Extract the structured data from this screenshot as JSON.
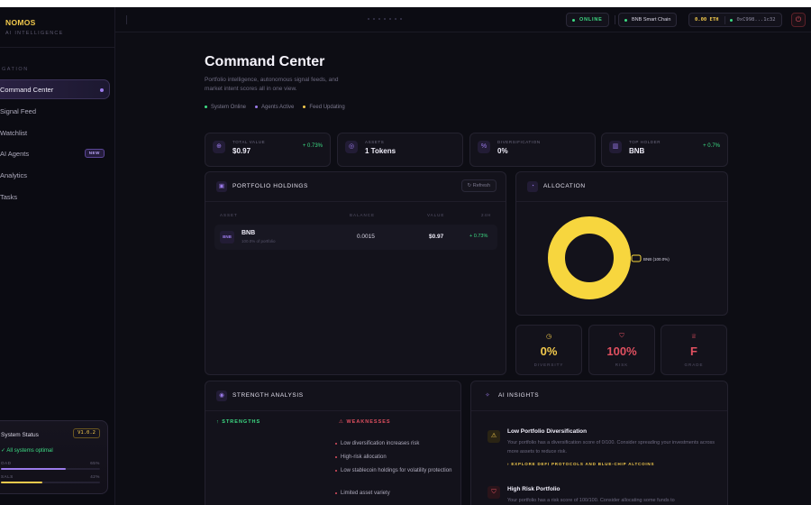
{
  "brand": {
    "name": "NOMOS",
    "tagline": "AI INTELLIGENCE"
  },
  "sidebar": {
    "heading": "GATION",
    "items": [
      {
        "label": "Command Center",
        "active": true
      },
      {
        "label": "Signal Feed"
      },
      {
        "label": "Watchlist"
      },
      {
        "label": "AI Agents",
        "badge": "NEW"
      },
      {
        "label": "Analytics"
      },
      {
        "label": "Tasks"
      }
    ],
    "status": {
      "title": "System Status",
      "version": "V1.0.2",
      "message": "All systems optimal",
      "bars": [
        {
          "label": "OAD",
          "value": "65%",
          "level": 0.65,
          "color": "#9b7bea"
        },
        {
          "label": "SALS",
          "value": "42%",
          "level": 0.42,
          "color": "#f2c94c"
        }
      ]
    }
  },
  "topbar": {
    "online": "ONLINE",
    "chain": "BNB Smart Chain",
    "eth": "0.00 ETH",
    "address": "0xC998...1c32",
    "power_icon": "power-icon"
  },
  "main": {
    "title": "Command Center",
    "subtitle": "Portfolio intelligence, autonomous signal feeds, and market intent scores all in one view.",
    "legend": [
      {
        "label": "System Online",
        "color": "#3ddc84"
      },
      {
        "label": "Agents Active",
        "color": "#9b7bea"
      },
      {
        "label": "Feed Updating",
        "color": "#f2c94c"
      }
    ]
  },
  "stats": [
    {
      "label": "TOTAL VALUE",
      "value": "$0.97",
      "delta": "+ 0.73%",
      "icon": "globe-icon"
    },
    {
      "label": "ASSETS",
      "value": "1 Tokens",
      "delta": "",
      "icon": "coins-icon"
    },
    {
      "label": "DIVERSIFICATION",
      "value": "0%",
      "delta": "",
      "icon": "percent-icon"
    },
    {
      "label": "TOP HOLDER",
      "value": "BNB",
      "delta": "+ 0.7%",
      "icon": "chart-icon"
    }
  ],
  "holdings": {
    "title": "PORTFOLIO HOLDINGS",
    "refresh": "Refresh",
    "columns": [
      "ASSET",
      "BALANCE",
      "VALUE",
      "24H"
    ],
    "rows": [
      {
        "badge": "BNB",
        "name": "BNB",
        "sub": "100.0% of portfolio",
        "balance": "0.0015",
        "value": "$0.97",
        "change": "+ 0.73%"
      }
    ]
  },
  "allocation": {
    "title": "ALLOCATION",
    "label": "BNB (100.0%)",
    "color": "#f7d63e"
  },
  "chart_data": {
    "type": "pie",
    "categories": [
      "BNB"
    ],
    "values": [
      100.0
    ],
    "title": "ALLOCATION",
    "labels": [
      "BNB (100.0%)"
    ]
  },
  "scores": [
    {
      "value": "0%",
      "label": "DIVERSITY",
      "color": "#f2c94c",
      "icon": "clock-icon"
    },
    {
      "value": "100%",
      "label": "RISK",
      "color": "#e05060",
      "icon": "shield-icon"
    },
    {
      "value": "F",
      "label": "GRADE",
      "color": "#e05060",
      "icon": "trophy-icon"
    }
  ],
  "strength": {
    "title": "STRENGTH ANALYSIS",
    "strengths_label": "STRENGTHS",
    "weaknesses_label": "WEAKNESSES",
    "weaknesses": [
      "Low diversification increases risk",
      "High-risk allocation",
      "Low stablecoin holdings for volatility protection",
      "Limited asset variety"
    ]
  },
  "insights": {
    "title": "AI INSIGHTS",
    "items": [
      {
        "title": "Low Portfolio Diversification",
        "body": "Your portfolio has a diversification score of 0/100. Consider spreading your investments across more assets to reduce risk.",
        "cta": "› EXPLORE DEFI PROTOCOLS AND BLUE-CHIP ALTCOINS"
      },
      {
        "title": "High Risk Portfolio",
        "body": "Your portfolio has a risk score of 100/100. Consider allocating some funds to"
      }
    ]
  }
}
